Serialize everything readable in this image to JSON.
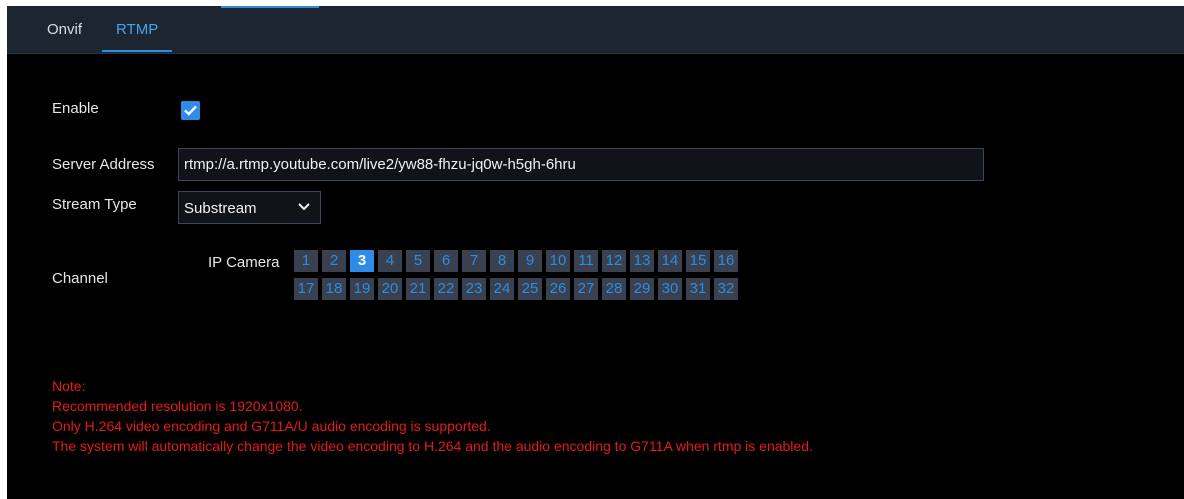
{
  "tabs": [
    {
      "label": "Onvif",
      "active": false
    },
    {
      "label": "RTMP",
      "active": true
    }
  ],
  "form": {
    "enable_label": "Enable",
    "enable_checked": true,
    "server_label": "Server Address",
    "server_value": "rtmp://a.rtmp.youtube.com/live2/yw88-fhzu-jq0w-h5gh-6hru",
    "stream_label": "Stream Type",
    "stream_value": "Substream",
    "channel_label": "Channel",
    "ip_camera_label": "IP Camera"
  },
  "channels": {
    "row1": [
      "1",
      "2",
      "3",
      "4",
      "5",
      "6",
      "7",
      "8",
      "9",
      "10",
      "11",
      "12",
      "13",
      "14",
      "15",
      "16"
    ],
    "row2": [
      "17",
      "18",
      "19",
      "20",
      "21",
      "22",
      "23",
      "24",
      "25",
      "26",
      "27",
      "28",
      "29",
      "30",
      "31",
      "32"
    ],
    "selected": "3"
  },
  "note": {
    "title": "Note:",
    "lines": [
      "Recommended resolution is 1920x1080.",
      "Only H.264 video encoding and G711A/U audio encoding is supported.",
      "The system will automatically change the video encoding to H.264 and the audio encoding to G711A when rtmp is enabled."
    ]
  },
  "colors": {
    "accent": "#2e8ce8",
    "note_text": "#e41b1b",
    "panel_bg": "#000000",
    "topbar_bg": "#1d2530"
  },
  "icons": {
    "checkbox": "checkmark-icon",
    "dropdown": "chevron-down-icon"
  }
}
